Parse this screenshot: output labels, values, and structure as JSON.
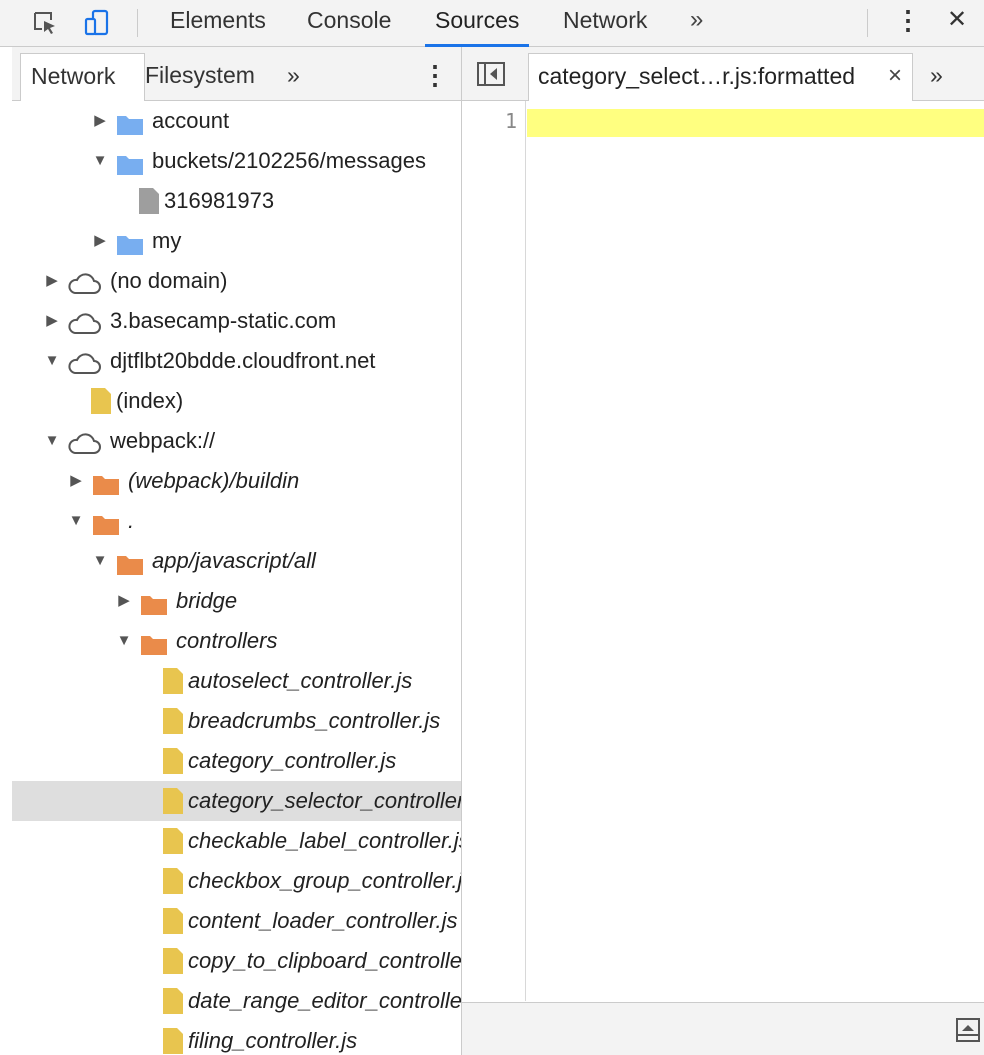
{
  "toolbar": {
    "tabs": [
      "Elements",
      "Console",
      "Sources",
      "Network"
    ],
    "active_tab": "Sources",
    "more_tabs": "»",
    "menu": "⋮",
    "close": "✕"
  },
  "navigator": {
    "tabs": [
      "Network",
      "Filesystem"
    ],
    "more": "»",
    "menu": "⋮"
  },
  "tree": [
    {
      "label": "account",
      "indent": 3,
      "expand": "collapsed",
      "icon": "folder-blue",
      "italic": false
    },
    {
      "label": "buckets/2102256/messages",
      "indent": 3,
      "expand": "expanded",
      "icon": "folder-blue",
      "italic": false
    },
    {
      "label": "316981973",
      "indent": 4,
      "expand": "none",
      "icon": "file-gray",
      "italic": false
    },
    {
      "label": "my",
      "indent": 3,
      "expand": "collapsed",
      "icon": "folder-blue",
      "italic": false
    },
    {
      "label": "(no domain)",
      "indent": 1,
      "expand": "collapsed",
      "icon": "cloud",
      "italic": false
    },
    {
      "label": "3.basecamp-static.com",
      "indent": 1,
      "expand": "collapsed",
      "icon": "cloud",
      "italic": false
    },
    {
      "label": "djtflbt20bdde.cloudfront.net",
      "indent": 1,
      "expand": "expanded",
      "icon": "cloud",
      "italic": false
    },
    {
      "label": "(index)",
      "indent": 2,
      "expand": "none",
      "icon": "file-yellow",
      "italic": false
    },
    {
      "label": "webpack://",
      "indent": 1,
      "expand": "expanded",
      "icon": "cloud",
      "italic": false
    },
    {
      "label": "(webpack)/buildin",
      "indent": 2,
      "expand": "collapsed",
      "icon": "folder-orange",
      "italic": true
    },
    {
      "label": ".",
      "indent": 2,
      "expand": "expanded",
      "icon": "folder-orange",
      "italic": true
    },
    {
      "label": "app/javascript/all",
      "indent": 3,
      "expand": "expanded",
      "icon": "folder-orange",
      "italic": true
    },
    {
      "label": "bridge",
      "indent": 4,
      "expand": "collapsed",
      "icon": "folder-orange",
      "italic": true
    },
    {
      "label": "controllers",
      "indent": 4,
      "expand": "expanded",
      "icon": "folder-orange",
      "italic": true
    },
    {
      "label": "autoselect_controller.js",
      "indent": 5,
      "expand": "none",
      "icon": "file-yellow",
      "italic": true
    },
    {
      "label": "breadcrumbs_controller.js",
      "indent": 5,
      "expand": "none",
      "icon": "file-yellow",
      "italic": true
    },
    {
      "label": "category_controller.js",
      "indent": 5,
      "expand": "none",
      "icon": "file-yellow",
      "italic": true
    },
    {
      "label": "category_selector_controller.js",
      "indent": 5,
      "expand": "none",
      "icon": "file-yellow",
      "italic": true,
      "selected": true
    },
    {
      "label": "checkable_label_controller.js",
      "indent": 5,
      "expand": "none",
      "icon": "file-yellow",
      "italic": true
    },
    {
      "label": "checkbox_group_controller.js",
      "indent": 5,
      "expand": "none",
      "icon": "file-yellow",
      "italic": true
    },
    {
      "label": "content_loader_controller.js",
      "indent": 5,
      "expand": "none",
      "icon": "file-yellow",
      "italic": true
    },
    {
      "label": "copy_to_clipboard_controller.js",
      "indent": 5,
      "expand": "none",
      "icon": "file-yellow",
      "italic": true
    },
    {
      "label": "date_range_editor_controller.js",
      "indent": 5,
      "expand": "none",
      "icon": "file-yellow",
      "italic": true
    },
    {
      "label": "filing_controller.js",
      "indent": 5,
      "expand": "none",
      "icon": "file-yellow",
      "italic": true
    }
  ],
  "editor": {
    "file_tab": "category_select…r.js:formatted",
    "close": "×",
    "more": "»",
    "line_number": "1"
  },
  "colors": {
    "folder_blue": "#78aef0",
    "folder_orange": "#ea8b4a",
    "file_yellow": "#e8c54f",
    "file_gray": "#9e9e9e",
    "highlight": "#ffff80",
    "accent": "#1a73e8"
  }
}
